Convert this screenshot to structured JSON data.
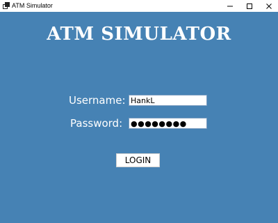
{
  "window": {
    "title": "ATM Simulator",
    "controls": {
      "minimize_icon": "minimize-icon",
      "maximize_icon": "maximize-icon",
      "close_icon": "close-icon"
    }
  },
  "app": {
    "heading": "ATM SIMULATOR",
    "background_color": "#4682b4"
  },
  "form": {
    "username_label": "Username:",
    "username_value": "HankL",
    "password_label": "Password:",
    "password_value": "●●●●●●●●",
    "login_label": "LOGIN"
  }
}
